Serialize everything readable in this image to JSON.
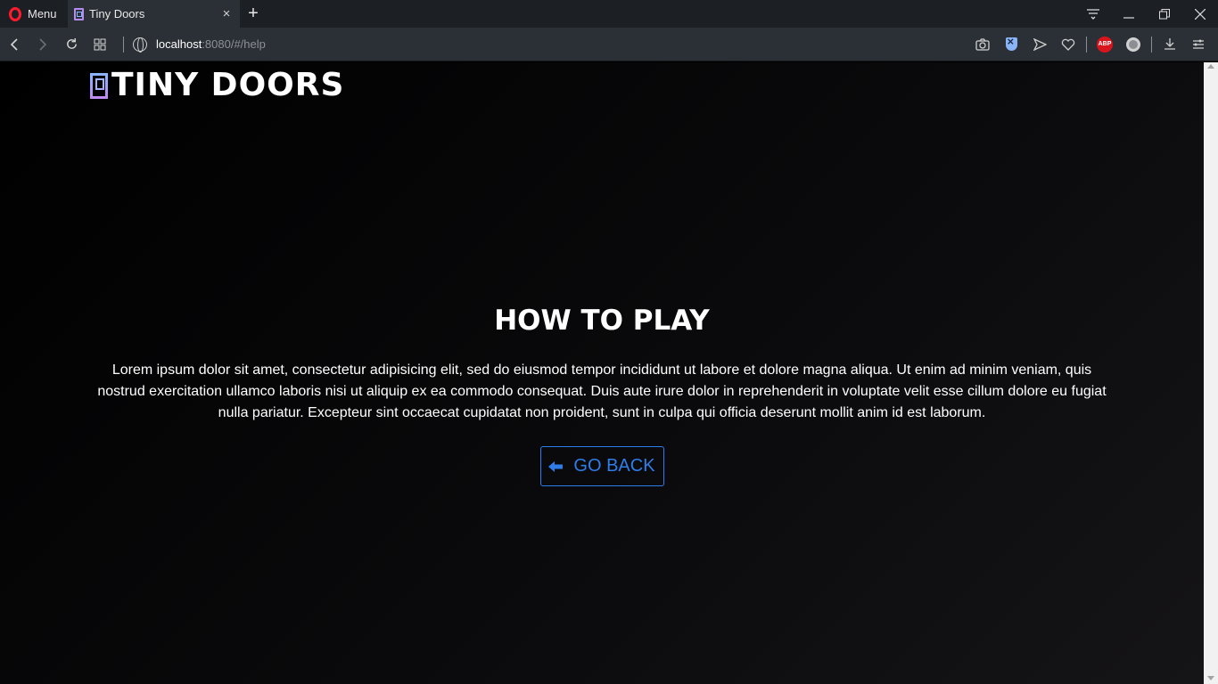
{
  "browser": {
    "menu_label": "Menu",
    "tab_title": "Tiny Doors",
    "tab_close": "×",
    "new_tab": "+",
    "url_host": "localhost",
    "url_rest": ":8080/#/help",
    "window_controls": [
      "easy-setup-icon",
      "minimize-icon",
      "restore-icon",
      "close-icon"
    ],
    "extensions": [
      "camera-icon",
      "shield-icon",
      "send-icon",
      "heart-icon",
      "adblock-icon",
      "vpn-icon",
      "download-icon",
      "sidebar-menu-icon"
    ],
    "abp_label": "ABP"
  },
  "header": {
    "logo_text": "TINY DOORS"
  },
  "main": {
    "title": "HOW TO PLAY",
    "body": "Lorem ipsum dolor sit amet, consectetur adipisicing elit, sed do eiusmod tempor incididunt ut labore et dolore magna aliqua. Ut enim ad minim veniam, quis nostrud exercitation ullamco laboris nisi ut aliquip ex ea commodo consequat. Duis aute irure dolor in reprehenderit in voluptate velit esse cillum dolore eu fugiat nulla pariatur. Excepteur sint occaecat cupidatat non proident, sunt in culpa qui officia deserunt mollit anim id est laborum.",
    "back_label": "GO BACK"
  },
  "colors": {
    "accent": "#2f7de8",
    "background": "#000000"
  }
}
